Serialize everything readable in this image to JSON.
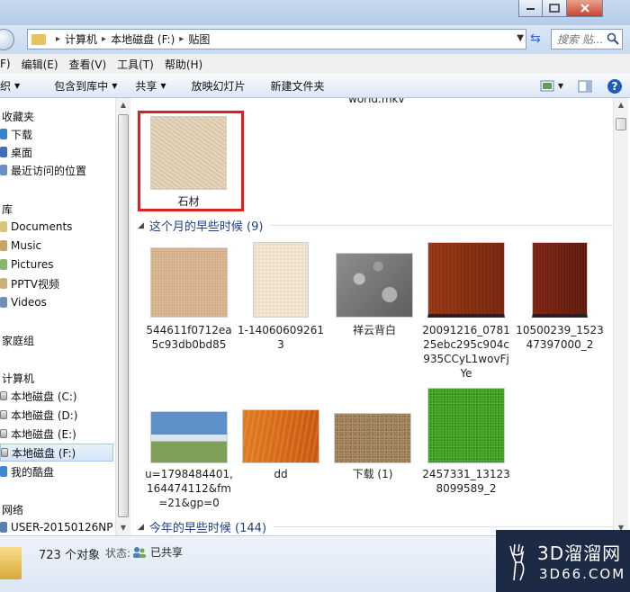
{
  "address": {
    "crumbs": [
      "计算机",
      "本地磁盘 (F:)",
      "贴图"
    ],
    "search_placeholder": "搜索 贴..."
  },
  "menu": [
    "F)",
    "编辑(E)",
    "查看(V)",
    "工具(T)",
    "帮助(H)"
  ],
  "toolbar": {
    "items": [
      "织",
      "包含到库中",
      "共享",
      "放映幻灯片",
      "新建文件夹"
    ]
  },
  "sidebar": {
    "favorites": "收藏夹",
    "fav_items": [
      "下载",
      "桌面",
      "最近访问的位置"
    ],
    "libraries": "库",
    "lib_items": [
      "Documents",
      "Music",
      "Pictures",
      "PPTV视频",
      "Videos"
    ],
    "homegroup": "家庭组",
    "computer": "计算机",
    "drives": [
      "本地磁盘 (C:)",
      "本地磁盘 (D:)",
      "本地磁盘 (E:)",
      "本地磁盘 (F:)",
      "我的酷盘"
    ],
    "network": "网络",
    "network_items": [
      "USER-20150126NP"
    ]
  },
  "content": {
    "cut_label": "world.mkv",
    "top_file": "石材",
    "group1": "这个月的早些时候 (9)",
    "group2": "今年的早些时候 (144)",
    "files": [
      "544611f0712ea5c93db0bd85",
      "1-140606092613",
      "祥云背白",
      "20091216_078125ebc295c904c935CCyL1wovFjYe",
      "10500239_152347397000_2",
      "u=1798484401,164474112&fm=21&gp=0",
      "dd",
      "下载 (1)",
      "2457331_131238099589_2"
    ]
  },
  "status": {
    "count": "723 个对象",
    "state_label": "状态:",
    "state_value": "已共享"
  },
  "watermark": {
    "line1": "3D溜溜网",
    "line2": "3D66.COM"
  }
}
